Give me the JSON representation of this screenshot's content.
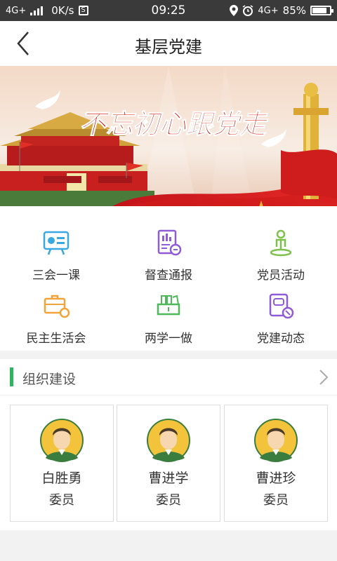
{
  "status_bar": {
    "network": "4G+",
    "speed": "0K/s",
    "time": "09:25",
    "network_right": "4G+",
    "battery": "85%",
    "battery_level": 0.85
  },
  "header": {
    "title": "基层党建",
    "back_icon": "chevron-left-icon"
  },
  "banner": {
    "slogan": "不忘初心跟党走"
  },
  "shortcuts": [
    {
      "label": "三会一课",
      "icon": "meeting-board-icon",
      "color": "#3aa8e0"
    },
    {
      "label": "督查通报",
      "icon": "report-chart-icon",
      "color": "#8f5bd6"
    },
    {
      "label": "党员活动",
      "icon": "person-pin-icon",
      "color": "#7dc14b"
    },
    {
      "label": "民主生活会",
      "icon": "briefcase-icon",
      "color": "#f2a33a"
    },
    {
      "label": "两学一做",
      "icon": "books-icon",
      "color": "#4fb85b"
    },
    {
      "label": "党建动态",
      "icon": "chat-document-icon",
      "color": "#8f5bd6"
    }
  ],
  "org_section": {
    "title": "组织建设",
    "accent": "#2db55d",
    "members": [
      {
        "name": "白胜勇",
        "role": "委员"
      },
      {
        "name": "曹进学",
        "role": "委员"
      },
      {
        "name": "曹进珍",
        "role": "委员"
      }
    ]
  }
}
